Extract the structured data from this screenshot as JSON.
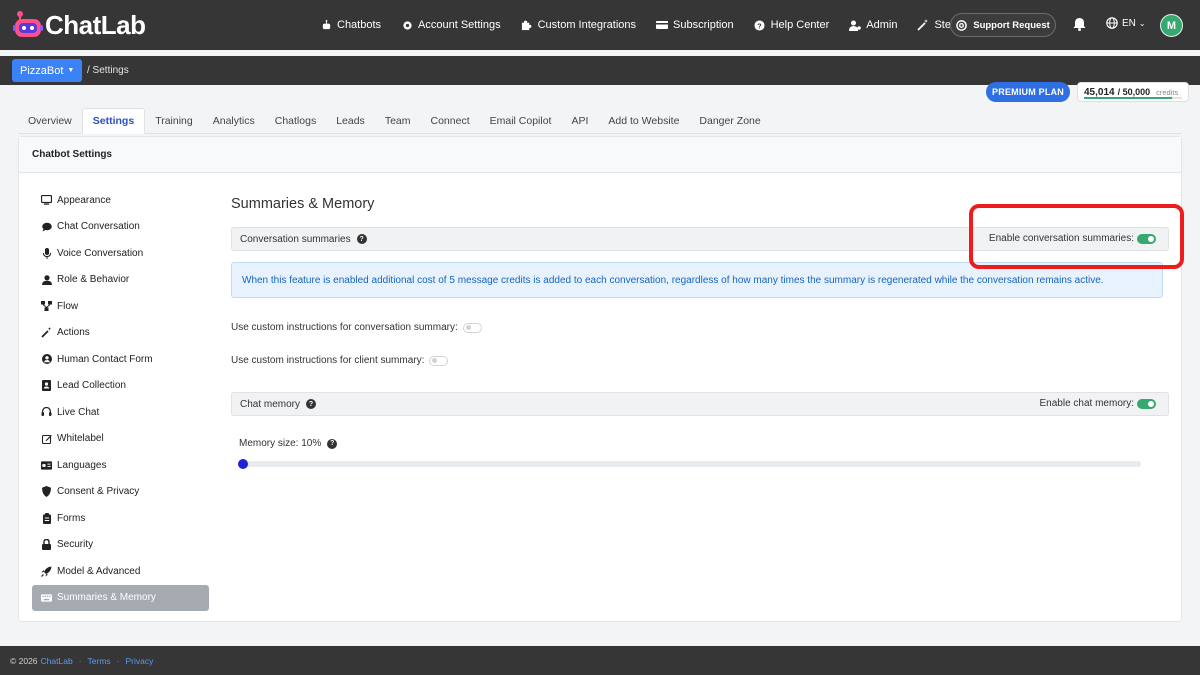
{
  "brand": {
    "name": "ChatLab"
  },
  "nav": {
    "items": [
      {
        "label": "Chatbots",
        "icon": "robot-icon"
      },
      {
        "label": "Account Settings",
        "icon": "gear-icon"
      },
      {
        "label": "Custom Integrations",
        "icon": "puzzle-icon"
      },
      {
        "label": "Subscription",
        "icon": "credit-card-icon"
      },
      {
        "label": "Help Center",
        "icon": "question-icon"
      },
      {
        "label": "Admin",
        "icon": "user-gear-icon"
      },
      {
        "label": "Stefan AI",
        "icon": "magic-wand-icon"
      }
    ],
    "support_label": "Support Request",
    "language": "EN",
    "avatar_initial": "M"
  },
  "subbar": {
    "bot_name": "PizzaBot",
    "breadcrumb": "/ Settings"
  },
  "plan": {
    "label": "PREMIUM PLAN"
  },
  "credits": {
    "used": "45,014",
    "total": "/ 50,000",
    "unit": "credits",
    "fraction_used": 0.9
  },
  "tabs": [
    "Overview",
    "Settings",
    "Training",
    "Analytics",
    "Chatlogs",
    "Leads",
    "Team",
    "Connect",
    "Email Copilot",
    "API",
    "Add to Website",
    "Danger Zone"
  ],
  "active_tab": "Settings",
  "card": {
    "title": "Chatbot Settings"
  },
  "sidebar": {
    "items": [
      {
        "label": "Appearance",
        "icon": "monitor-icon"
      },
      {
        "label": "Chat Conversation",
        "icon": "chat-icon"
      },
      {
        "label": "Voice Conversation",
        "icon": "microphone-icon"
      },
      {
        "label": "Role & Behavior",
        "icon": "user-icon"
      },
      {
        "label": "Flow",
        "icon": "flow-icon"
      },
      {
        "label": "Actions",
        "icon": "wand-icon"
      },
      {
        "label": "Human Contact Form",
        "icon": "user-circle-icon"
      },
      {
        "label": "Lead Collection",
        "icon": "contact-card-icon"
      },
      {
        "label": "Live Chat",
        "icon": "headset-icon"
      },
      {
        "label": "Whitelabel",
        "icon": "edit-icon"
      },
      {
        "label": "Languages",
        "icon": "language-icon"
      },
      {
        "label": "Consent & Privacy",
        "icon": "shield-icon"
      },
      {
        "label": "Forms",
        "icon": "clipboard-icon"
      },
      {
        "label": "Security",
        "icon": "lock-icon"
      },
      {
        "label": "Model & Advanced",
        "icon": "rocket-icon"
      },
      {
        "label": "Summaries & Memory",
        "icon": "keyboard-icon"
      }
    ],
    "active": "Summaries & Memory"
  },
  "main": {
    "title": "Summaries & Memory",
    "conv_summaries": {
      "label": "Conversation summaries",
      "toggle_label": "Enable conversation summaries:",
      "enabled": true
    },
    "info": "When this feature is enabled additional cost of 5 message credits is added to each conversation, regardless of how many times the summary is regenerated while the conversation remains active.",
    "custom_conv": {
      "label": "Use custom instructions for conversation summary:",
      "enabled": false
    },
    "custom_client": {
      "label": "Use custom instructions for client summary:",
      "enabled": false
    },
    "chat_memory": {
      "label": "Chat memory",
      "toggle_label": "Enable chat memory:",
      "enabled": true
    },
    "memory_size": {
      "label": "Memory size: 10%",
      "value_percent": 10
    }
  },
  "footer": {
    "copyright": "© 2026",
    "brand": "ChatLab",
    "terms": "Terms",
    "privacy": "Privacy"
  },
  "colors": {
    "accent": "#3b82f6",
    "toggle_on": "#35a970",
    "highlight": "#ee1c1c",
    "nav_bg": "#363636"
  }
}
